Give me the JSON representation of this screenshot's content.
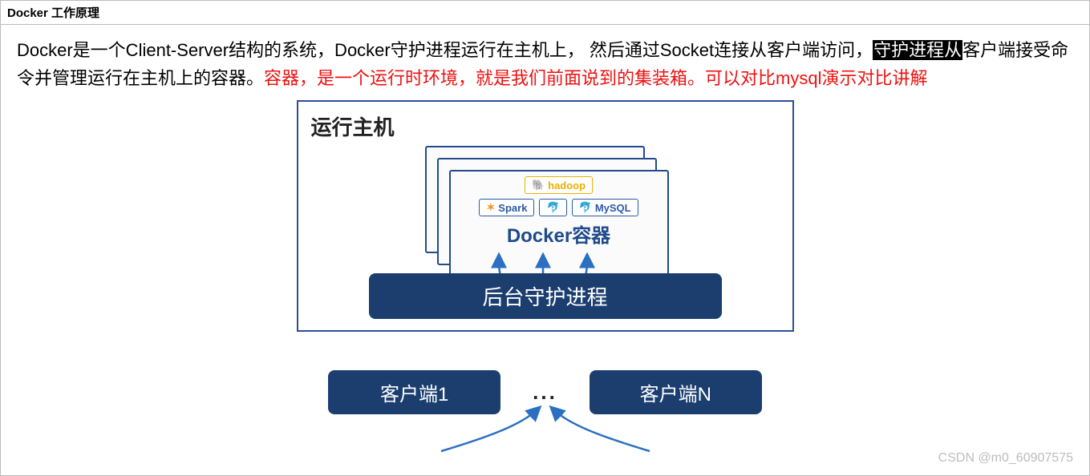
{
  "title": "Docker 工作原理",
  "paragraph": {
    "p1a": "Docker是一个Client-Server结构的系统，Docker守护进程运行在主机上， 然后通过Socket连接从客户端访问，",
    "p1_hl": "守护进程从",
    "p1b": "客户端接受命令并管理运行在主机上的容器。",
    "p1_red1": "容器，是一个运行时环境，就是我们前面说到的集装箱。",
    "p1_red2": "可以对比mysql演示对比讲解"
  },
  "diagram": {
    "host_label": "运行主机",
    "container_label": "Docker容器",
    "badges": {
      "hadoop": "hadoop",
      "spark": "Spark",
      "app": "🐬",
      "mysql": "MySQL"
    },
    "daemon_label": "后台守护进程",
    "client1": "客户端1",
    "clientN": "客户端N",
    "ellipsis": "..."
  },
  "watermark": "CSDN @m0_60907575",
  "chart_data": {
    "type": "diagram",
    "title": "Docker 工作原理",
    "nodes": [
      {
        "id": "host",
        "label": "运行主机",
        "contains": [
          "containers",
          "daemon"
        ]
      },
      {
        "id": "containers",
        "label": "Docker容器",
        "stack_count": 3,
        "apps": [
          "hadoop",
          "Spark",
          "MySQL"
        ]
      },
      {
        "id": "daemon",
        "label": "后台守护进程"
      },
      {
        "id": "client1",
        "label": "客户端1"
      },
      {
        "id": "clientN",
        "label": "客户端N"
      }
    ],
    "edges": [
      {
        "from": "daemon",
        "to": "containers",
        "count": 3,
        "direction": "up"
      },
      {
        "from": "client1",
        "to": "daemon",
        "direction": "up"
      },
      {
        "from": "clientN",
        "to": "daemon",
        "direction": "up"
      }
    ]
  }
}
